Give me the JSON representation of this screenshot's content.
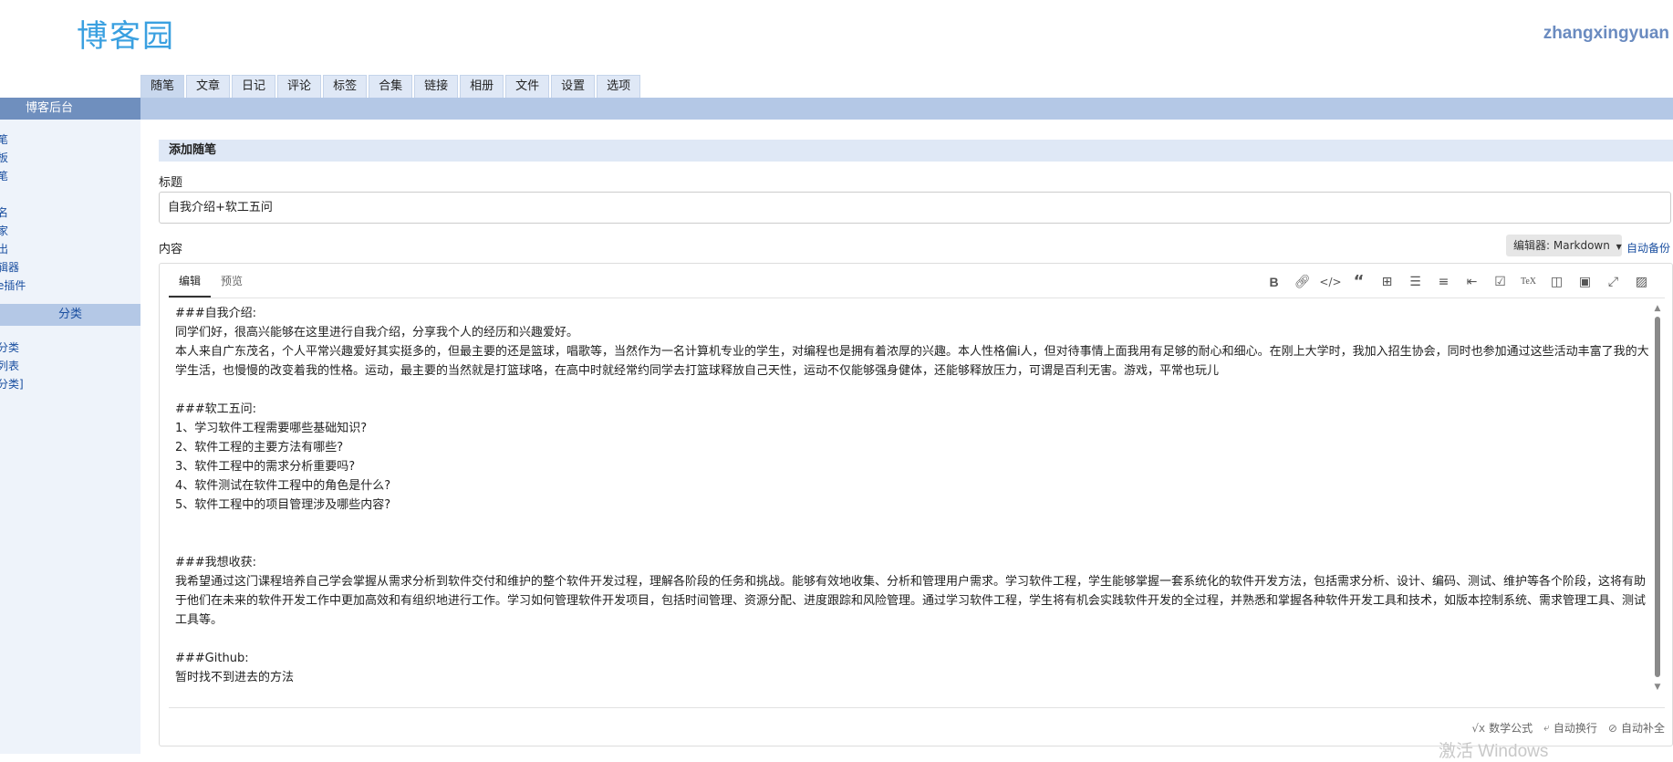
{
  "header": {
    "logo": "博客园",
    "username": "zhangxingyuan"
  },
  "nav_tabs": [
    {
      "label": "随笔",
      "active": true
    },
    {
      "label": "文章",
      "active": false
    },
    {
      "label": "日记",
      "active": false
    },
    {
      "label": "评论",
      "active": false
    },
    {
      "label": "标签",
      "active": false
    },
    {
      "label": "合集",
      "active": false
    },
    {
      "label": "链接",
      "active": false
    },
    {
      "label": "相册",
      "active": false
    },
    {
      "label": "文件",
      "active": false
    },
    {
      "label": "设置",
      "active": false
    },
    {
      "label": "选项",
      "active": false
    }
  ],
  "sidebar": {
    "heading": "博客后台",
    "group1": [
      "笔",
      "板",
      "笔"
    ],
    "group2": [
      "名",
      "家",
      "出",
      "辑器",
      "e插件"
    ],
    "category_heading": "分类",
    "group3": [
      "分类",
      "列表",
      "分类]"
    ]
  },
  "form": {
    "section_title": "添加随笔",
    "title_label": "标题",
    "title_value": "自我介绍+软工五问",
    "content_label": "内容",
    "editor_select": "编辑器: Markdown",
    "auto_backup": "自动备份"
  },
  "editor": {
    "tabs": [
      "编辑",
      "预览"
    ],
    "toolbar_icons": [
      "bold-icon",
      "link-icon",
      "code-icon",
      "quote-icon",
      "table-icon",
      "bullet-list-icon",
      "numbered-list-icon",
      "indent-icon",
      "checkbox-icon",
      "tex-icon",
      "split-view-icon",
      "save-icon",
      "fullscreen-icon",
      "image-icon"
    ],
    "content": "###自我介绍:\n同学们好，很高兴能够在这里进行自我介绍，分享我个人的经历和兴趣爱好。\n本人来自广东茂名，个人平常兴趣爱好其实挺多的，但最主要的还是篮球，唱歌等，当然作为一名计算机专业的学生，对编程也是拥有着浓厚的兴趣。本人性格偏i人，但对待事情上面我用有足够的耐心和细心。在刚上大学时，我加入招生协会，同时也参加通过这些活动丰富了我的大学生活，也慢慢的改变着我的性格。运动，最主要的当然就是打篮球咯，在高中时就经常约同学去打篮球释放自己天性，运动不仅能够强身健体，还能够释放压力，可谓是百利无害。游戏，平常也玩儿\n\n###软工五问:\n1、学习软件工程需要哪些基础知识?\n2、软件工程的主要方法有哪些?\n3、软件工程中的需求分析重要吗?\n4、软件测试在软件工程中的角色是什么?\n5、软件工程中的项目管理涉及哪些内容?\n\n\n###我想收获:\n我希望通过这门课程培养自己学会掌握从需求分析到软件交付和维护的整个软件开发过程，理解各阶段的任务和挑战。能够有效地收集、分析和管理用户需求。学习软件工程，学生能够掌握一套系统化的软件开发方法，包括需求分析、设计、编码、测试、维护等各个阶段，这将有助于他们在未来的软件开发工作中更加高效和有组织地进行工作。学习如何管理软件开发项目，包括时间管理、资源分配、进度跟踪和风险管理。通过学习软件工程，学生将有机会实践软件开发的全过程，并熟悉和掌握各种软件开发工具和技术，如版本控制系统、需求管理工具、测试工具等。\n\n###Github:\n暂时找不到进去的方法",
    "status": [
      "数学公式",
      "自动换行",
      "自动补全"
    ]
  },
  "watermark": "激活 Windows"
}
